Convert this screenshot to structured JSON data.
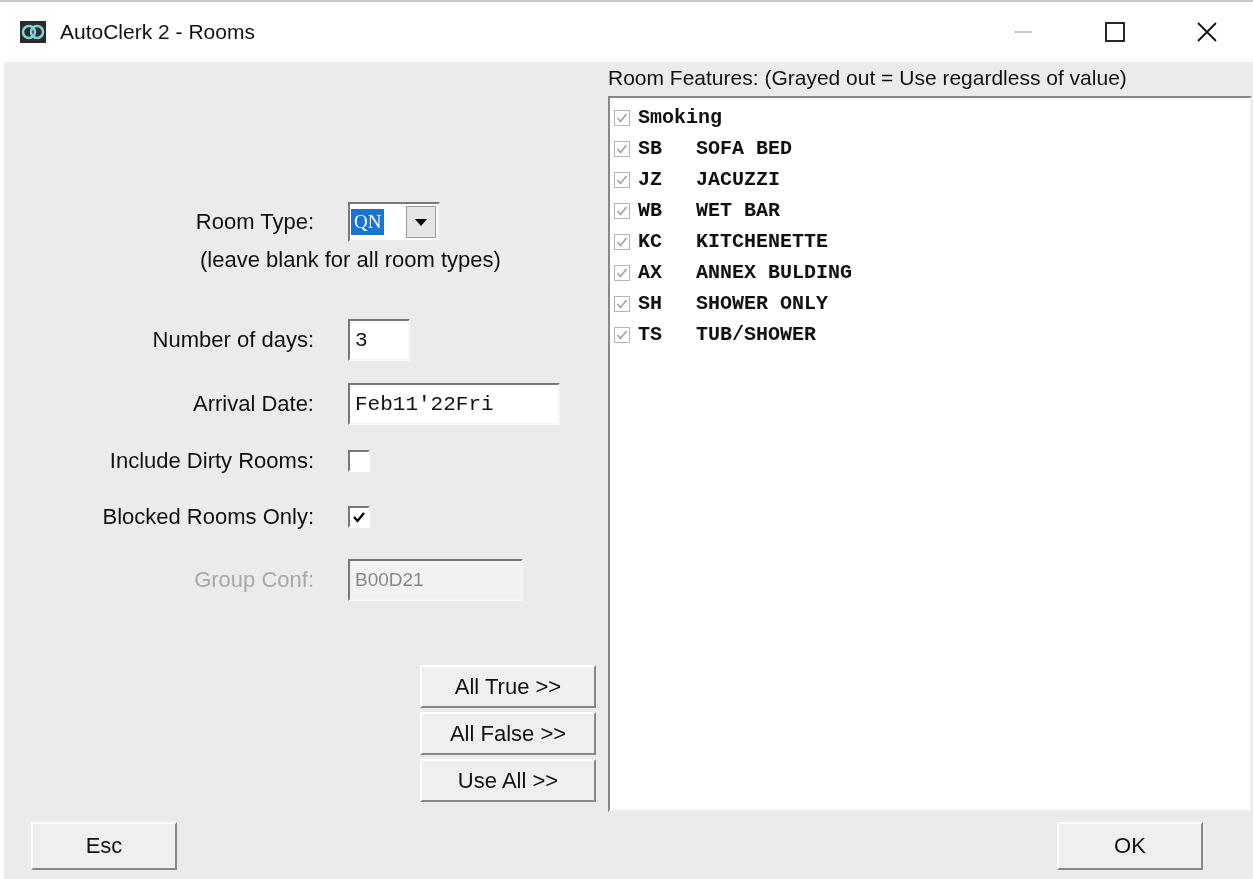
{
  "window": {
    "title": "AutoClerk 2 - Rooms"
  },
  "form": {
    "fields": [
      {
        "kind": "dropdown",
        "label": "Room Type:",
        "value": "QN",
        "disabled": false,
        "hint": "(leave blank for all room types)"
      },
      {
        "kind": "number",
        "label": "Number of days:",
        "value": "3",
        "disabled": false
      },
      {
        "kind": "text",
        "label": "Arrival Date:",
        "value": "Feb11'22Fri",
        "disabled": false
      },
      {
        "kind": "checkbox",
        "label": "Include Dirty Rooms:",
        "checked": false,
        "disabled": false
      },
      {
        "kind": "checkbox",
        "label": "Blocked Rooms Only:",
        "checked": true,
        "disabled": false
      },
      {
        "kind": "text",
        "label": "Group Conf:",
        "value": "B00D21",
        "disabled": true
      }
    ]
  },
  "feature_buttons": [
    "All True  >>",
    "All False  >>",
    "Use All  >>"
  ],
  "features": {
    "title": "Room Features:  (Grayed out = Use regardless of value)",
    "items": [
      {
        "code": "Smoking",
        "checked": true,
        "grayed": true
      },
      {
        "code": "SB",
        "name": "SOFA BED",
        "checked": true,
        "grayed": true
      },
      {
        "code": "JZ",
        "name": "JACUZZI",
        "checked": true,
        "grayed": true
      },
      {
        "code": "WB",
        "name": "WET BAR",
        "checked": true,
        "grayed": true
      },
      {
        "code": "KC",
        "name": "KITCHENETTE",
        "checked": true,
        "grayed": true
      },
      {
        "code": "AX",
        "name": "ANNEX BULDING",
        "checked": true,
        "grayed": true
      },
      {
        "code": "SH",
        "name": "SHOWER ONLY",
        "checked": true,
        "grayed": true
      },
      {
        "code": "TS",
        "name": "TUB/SHOWER",
        "checked": true,
        "grayed": true
      }
    ]
  },
  "footer": {
    "cancel": "Esc",
    "ok": "OK"
  }
}
